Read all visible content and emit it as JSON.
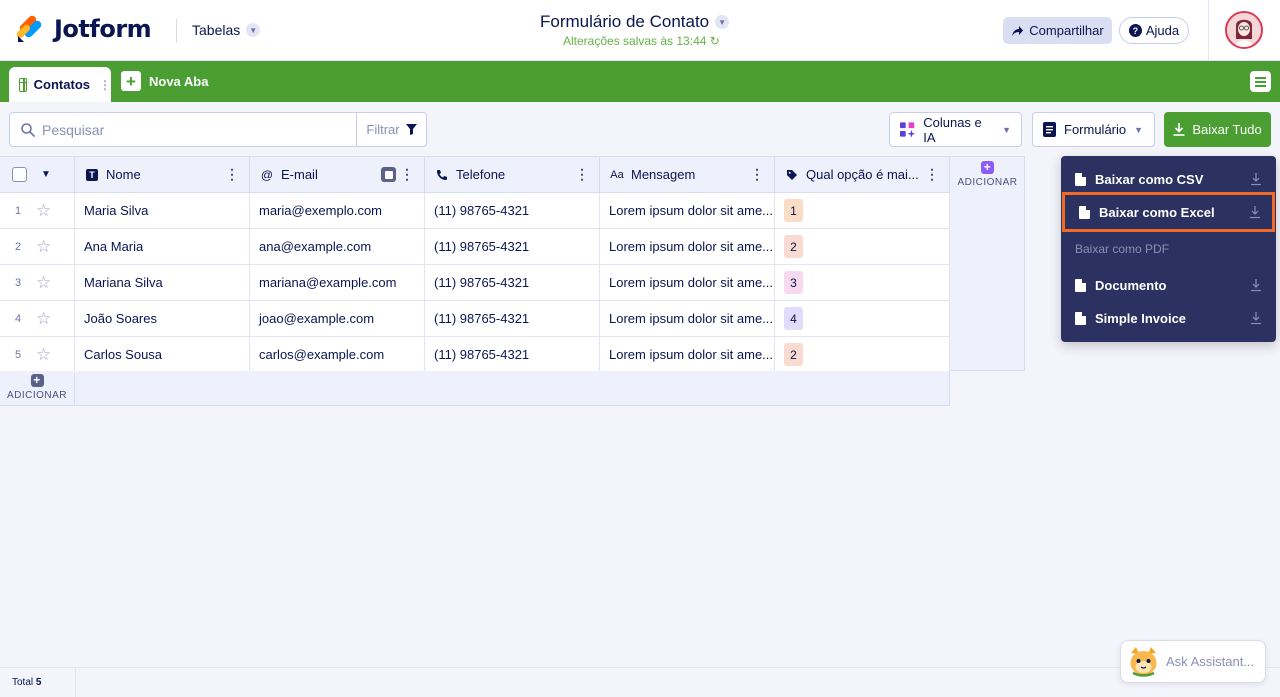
{
  "header": {
    "brand": "Jotform",
    "tables_label": "Tabelas",
    "form_title": "Formulário de Contato",
    "saved_status": "Alterações salvas às 13:44",
    "share_label": "Compartilhar",
    "help_label": "Ajuda"
  },
  "tabs": {
    "active_label": "Contatos",
    "new_tab_label": "Nova Aba"
  },
  "toolbar": {
    "search_placeholder": "Pesquisar",
    "filter_label": "Filtrar",
    "columns_ai_label": "Colunas e IA",
    "form_label": "Formulário",
    "download_all_label": "Baixar Tudo"
  },
  "table": {
    "columns": [
      {
        "label": "Nome",
        "icon": "text-icon"
      },
      {
        "label": "E-mail",
        "icon": "at-icon"
      },
      {
        "label": "Telefone",
        "icon": "phone-icon"
      },
      {
        "label": "Mensagem",
        "icon": "aa-icon"
      },
      {
        "label": "Qual opção é mai...",
        "icon": "tag-icon"
      }
    ],
    "add_label": "ADICIONAR",
    "rows": [
      {
        "num": "1",
        "nome": "Maria Silva",
        "email": "maria@exemplo.com",
        "telefone": "(11) 98765-4321",
        "mensagem": "Lorem ipsum dolor sit ame...",
        "opcao": "1",
        "opcao_color": "#fbdcc4"
      },
      {
        "num": "2",
        "nome": "Ana Maria",
        "email": "ana@example.com",
        "telefone": "(11) 98765-4321",
        "mensagem": "Lorem ipsum dolor sit ame...",
        "opcao": "2",
        "opcao_color": "#fadbd2"
      },
      {
        "num": "3",
        "nome": "Mariana Silva",
        "email": "mariana@example.com",
        "telefone": "(11) 98765-4321",
        "mensagem": "Lorem ipsum dolor sit ame...",
        "opcao": "3",
        "opcao_color": "#f7d9f0"
      },
      {
        "num": "4",
        "nome": "João Soares",
        "email": "joao@example.com",
        "telefone": "(11) 98765-4321",
        "mensagem": "Lorem ipsum dolor sit ame...",
        "opcao": "4",
        "opcao_color": "#e2dcfb"
      },
      {
        "num": "5",
        "nome": "Carlos Sousa",
        "email": "carlos@example.com",
        "telefone": "(11) 98765-4321",
        "mensagem": "Lorem ipsum dolor sit ame...",
        "opcao": "2",
        "opcao_color": "#fadbd2"
      }
    ]
  },
  "download_menu": {
    "csv_label": "Baixar como CSV",
    "excel_label": "Baixar como Excel",
    "pdf_section": "Baixar como PDF",
    "document_label": "Documento",
    "invoice_label": "Simple Invoice"
  },
  "footer": {
    "total_label": "Total",
    "total_value": "5",
    "assistant_label": "Ask Assistant..."
  },
  "colors": {
    "brand_green": "#4a9e32",
    "highlight_orange": "#f26a25",
    "menu_bg": "#2b3160"
  }
}
